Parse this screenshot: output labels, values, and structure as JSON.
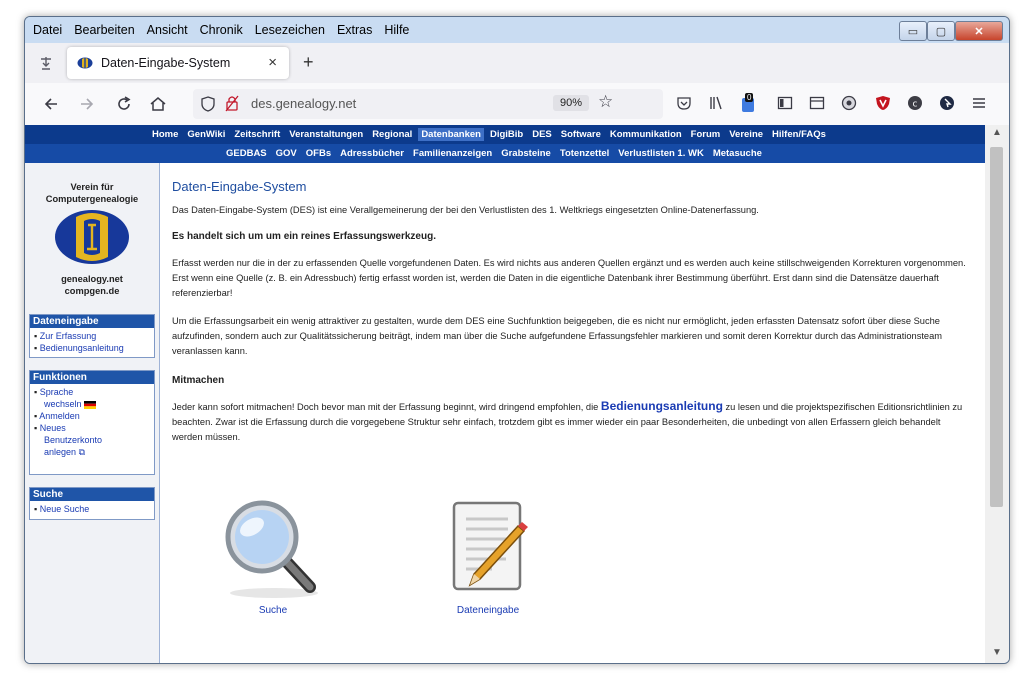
{
  "menubar": {
    "items": [
      "Datei",
      "Bearbeiten",
      "Ansicht",
      "Chronik",
      "Lesezeichen",
      "Extras",
      "Hilfe"
    ]
  },
  "window_controls": {
    "minimize": "▭",
    "maximize": "▢",
    "close": "✕"
  },
  "tab": {
    "title": "Daten-Eingabe-System",
    "close": "×",
    "new": "+"
  },
  "url": {
    "text": "des.genealogy.net",
    "zoom": "90%",
    "badge": "0"
  },
  "nav_top": [
    "Home",
    "GenWiki",
    "Zeitschrift",
    "Veranstaltungen",
    "Regional",
    "Datenbanken",
    "DigiBib",
    "DES",
    "Software",
    "Kommunikation",
    "Forum",
    "Vereine",
    "Hilfen/FAQs"
  ],
  "nav_sub": [
    "GEDBAS",
    "GOV",
    "OFBs",
    "Adressbücher",
    "Familienanzeigen",
    "Grabsteine",
    "Totenzettel",
    "Verlustlisten 1. WK",
    "Metasuche"
  ],
  "sidebar": {
    "org_line1": "Verein für",
    "org_line2": "Computergenealogie",
    "site1": "genealogy.net",
    "site2": "compgen.de",
    "box1_title": "Dateneingabe",
    "box1_items": [
      "Zur Erfassung",
      "Bedienungsanleitung"
    ],
    "box2_title": "Funktionen",
    "box2_items": [
      "Sprache",
      "wechseln",
      "Anmelden",
      "Neues",
      "Benutzerkonto",
      "anlegen"
    ],
    "box3_title": "Suche",
    "box3_items": [
      "Neue Suche"
    ]
  },
  "main": {
    "title": "Daten-Eingabe-System",
    "p1": "Das Daten-Eingabe-System (DES) ist eine Verallgemeinerung der bei den Verlustlisten des 1. Weltkriegs eingesetzten Online-Datenerfassung.",
    "p2": "Es handelt sich um um ein reines Erfassungswerkzeug.",
    "p3": "Erfasst werden nur die in der zu erfassenden Quelle vorgefundenen Daten. Es wird nichts aus anderen Quellen ergänzt und es werden auch keine stillschweigenden Korrekturen vorgenommen. Erst wenn eine Quelle (z. B. ein Adressbuch) fertig erfasst worden ist, werden die Daten in die eigentliche Datenbank ihrer Bestimmung überführt. Erst dann sind die Datensätze dauerhaft referenzierbar!",
    "p4": "Um die Erfassungsarbeit ein wenig attraktiver zu gestalten, wurde dem DES eine Suchfunktion beigegeben, die es nicht nur ermöglicht, jeden erfassten Datensatz sofort über diese Suche aufzufinden, sondern auch zur Qualitätssicherung beiträgt, indem man über die Suche aufgefundene Erfassungsfehler markieren und somit deren Korrektur durch das Administrationsteam veranlassen kann.",
    "h_mitmachen": "Mitmachen",
    "p5_pre": "Jeder kann sofort mitmachen! Doch bevor man mit der Erfassung beginnt, wird dringend empfohlen, die ",
    "p5_link": "Bedienungsanleitung",
    "p5_post": " zu lesen und die projektspezifischen Editionsrichtlinien zu beachten. Zwar ist die Erfassung durch die vorgegebene Struktur sehr einfach, trotzdem gibt es immer wieder ein paar Besonderheiten, die unbedingt von allen Erfassern gleich behandelt werden müssen.",
    "icon_search_label": "Suche",
    "icon_entry_label": "Dateneingabe"
  }
}
